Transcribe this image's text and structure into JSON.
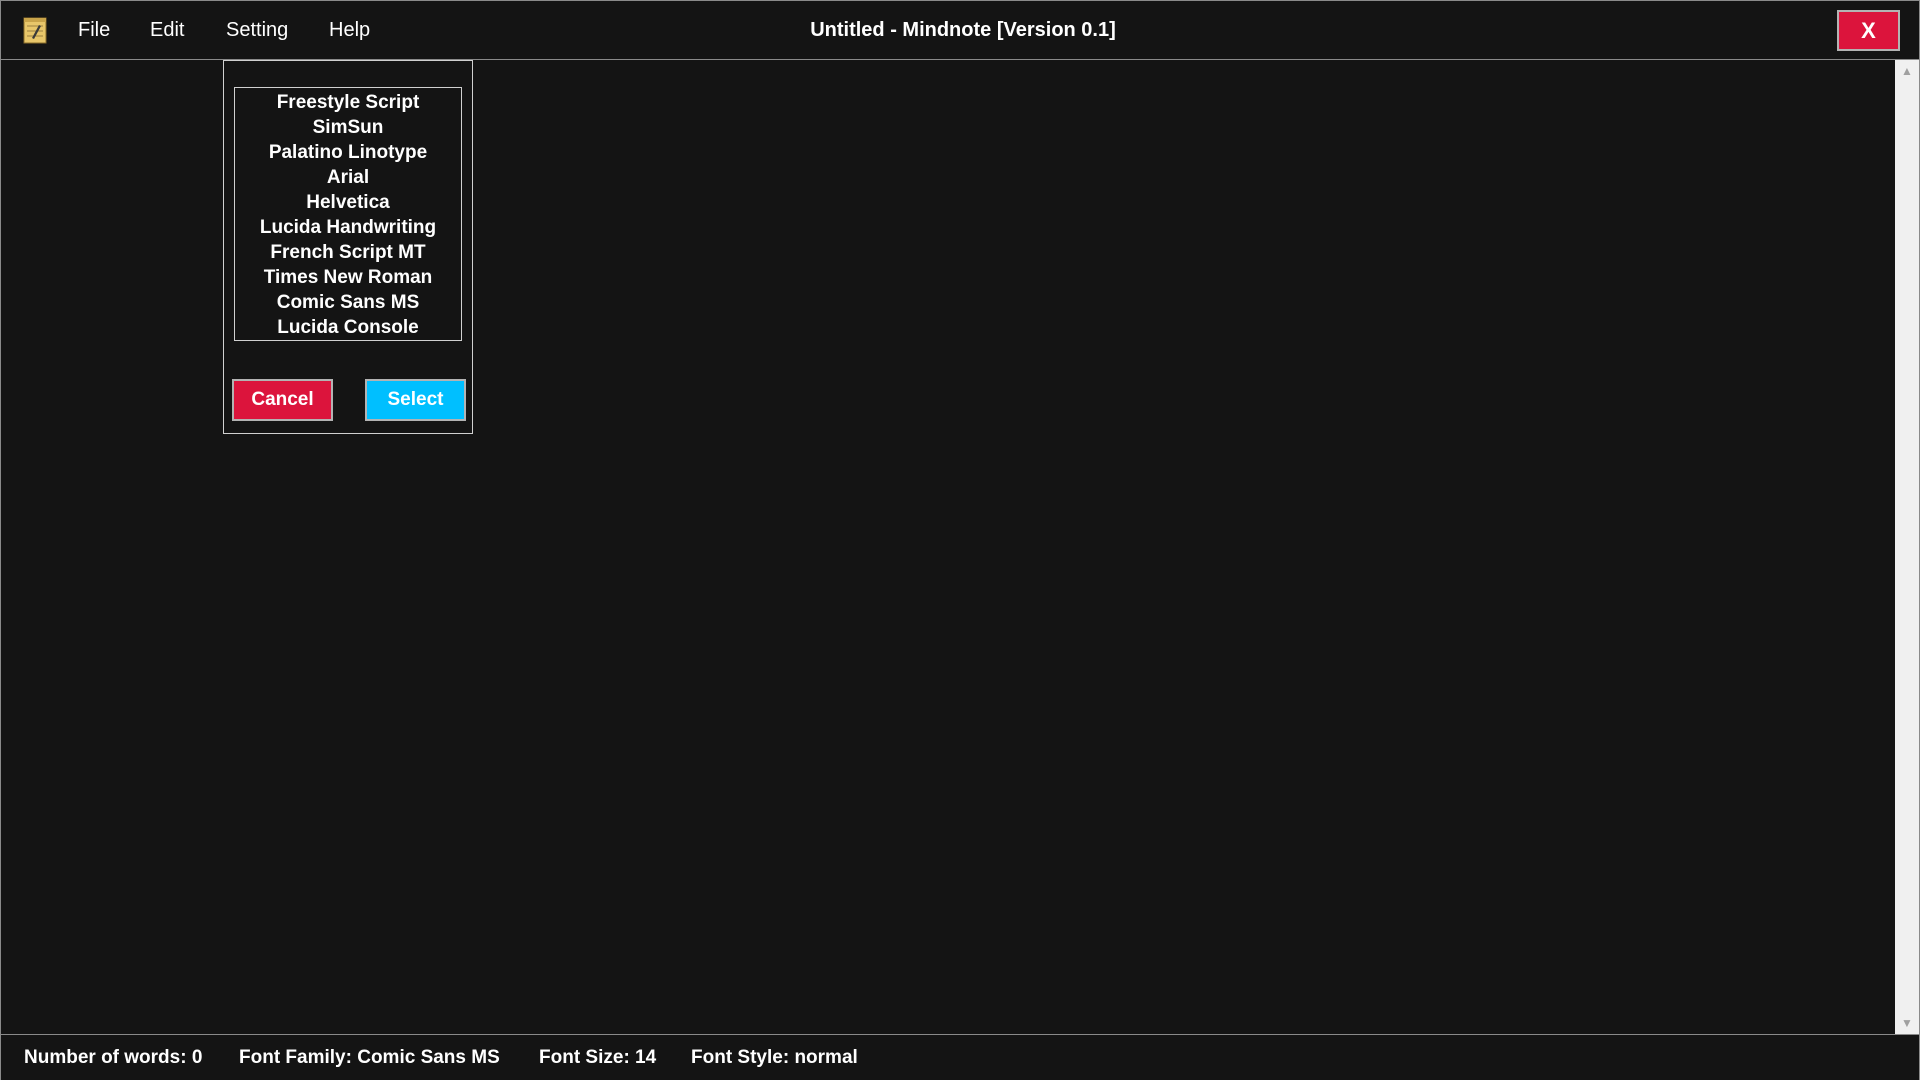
{
  "app": {
    "title": "Untitled - Mindnote [Version 0.1]",
    "icon": "notepad-icon",
    "close_label": "X"
  },
  "menu": {
    "items": [
      {
        "label": "File"
      },
      {
        "label": "Edit"
      },
      {
        "label": "Setting"
      },
      {
        "label": "Help"
      }
    ]
  },
  "font_dialog": {
    "fonts": [
      "Freestyle Script",
      "SimSun",
      "Palatino Linotype",
      "Arial",
      "Helvetica",
      "Lucida Handwriting",
      "French Script MT",
      "Times New Roman",
      "Comic Sans MS",
      "Lucida Console"
    ],
    "cancel_label": "Cancel",
    "select_label": "Select"
  },
  "editor": {
    "content": ""
  },
  "status": {
    "words": "Number of words: 0",
    "family": "Font Family: Comic Sans MS",
    "size": "Font Size: 14",
    "style": "Font Style: normal"
  },
  "colors": {
    "background": "#141414",
    "cancel": "#dc143c",
    "select": "#00bfff",
    "close": "#dc143c"
  }
}
